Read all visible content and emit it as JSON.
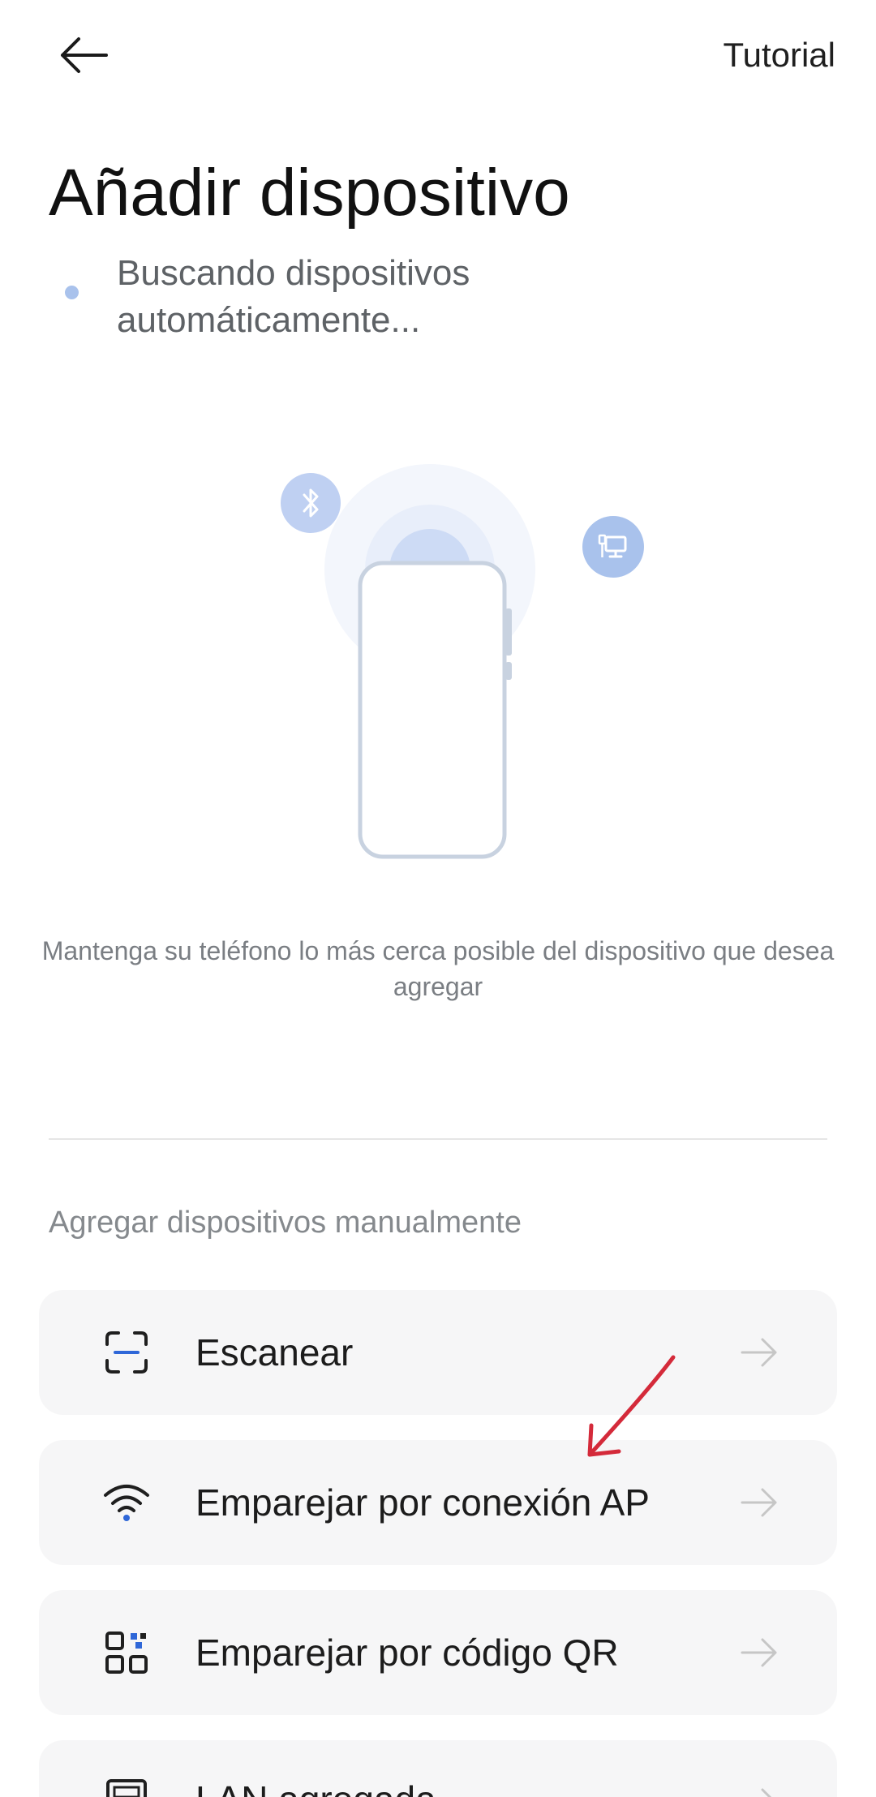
{
  "header": {
    "back_icon": "arrow-left-icon",
    "tutorial_label": "Tutorial"
  },
  "title": "Añadir dispositivo",
  "status": {
    "text": "Buscando dispositivos automáticamente..."
  },
  "illustration": {
    "icons": [
      "bluetooth-icon",
      "network-device-icon",
      "phone-outline"
    ]
  },
  "hint": "Mantenga su teléfono lo más cerca posible del dispositivo que desea agregar",
  "manual": {
    "section_label": "Agregar dispositivos manualmente",
    "options": [
      {
        "label": "Escanear",
        "icon": "scan-icon"
      },
      {
        "label": "Emparejar por conexión AP",
        "icon": "wifi-icon"
      },
      {
        "label": "Emparejar por código QR",
        "icon": "qr-code-icon"
      },
      {
        "label": "LAN agregada",
        "icon": "lan-device-icon"
      }
    ]
  },
  "colors": {
    "accent_blue": "#a9c2ec",
    "card_bg": "#f6f6f7",
    "annotation_red": "#d42a3a"
  }
}
